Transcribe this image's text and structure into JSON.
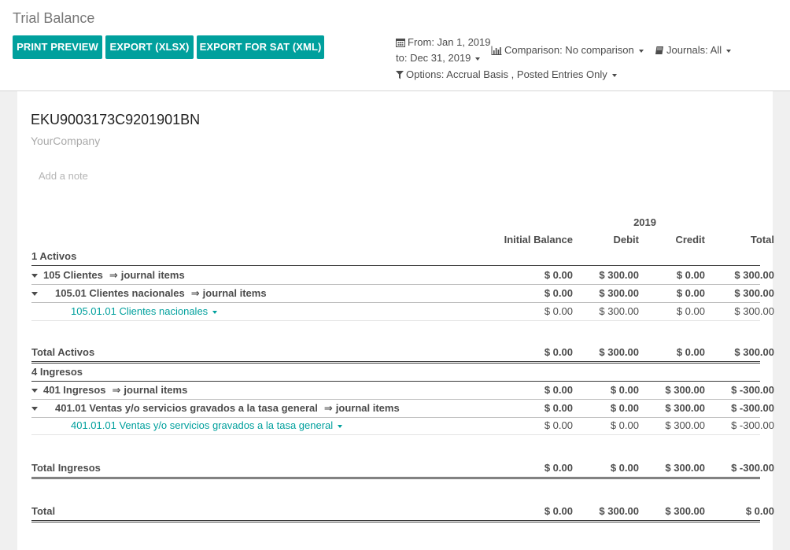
{
  "header": {
    "title": "Trial Balance",
    "buttons": {
      "print": "PRINT PREVIEW",
      "xlsx": "EXPORT (XLSX)",
      "sat": "EXPORT FOR SAT (XML)"
    },
    "date_from": "From: Jan 1, 2019",
    "date_to": "to: Dec 31, 2019",
    "comparison": "Comparison: No comparison",
    "journals": "Journals: All",
    "options": "Options: Accrual Basis , Posted Entries Only"
  },
  "report": {
    "company_id": "EKU9003173C9201901BN",
    "company_name": "YourCompany",
    "note_placeholder": "Add a note",
    "year": "2019",
    "columns": [
      "Initial Balance",
      "Debit",
      "Credit",
      "Total"
    ],
    "journal_items": "journal items",
    "arrow": "⇒",
    "sections": {
      "activos": {
        "title": "1 Activos",
        "group": {
          "label": "105 Clientes",
          "values": [
            "$ 0.00",
            "$ 300.00",
            "$ 0.00",
            "$ 300.00"
          ]
        },
        "sub": {
          "label": "105.01 Clientes nacionales",
          "values": [
            "$ 0.00",
            "$ 300.00",
            "$ 0.00",
            "$ 300.00"
          ]
        },
        "account": {
          "label": "105.01.01 Clientes nacionales",
          "values": [
            "$ 0.00",
            "$ 300.00",
            "$ 0.00",
            "$ 300.00"
          ]
        },
        "total": {
          "label": "Total Activos",
          "values": [
            "$ 0.00",
            "$ 300.00",
            "$ 0.00",
            "$ 300.00"
          ]
        }
      },
      "ingresos": {
        "title": "4 Ingresos",
        "group": {
          "label": "401 Ingresos",
          "values": [
            "$ 0.00",
            "$ 0.00",
            "$ 300.00",
            "$ -300.00"
          ]
        },
        "sub": {
          "label": "401.01 Ventas y/o servicios gravados a la tasa general",
          "values": [
            "$ 0.00",
            "$ 0.00",
            "$ 300.00",
            "$ -300.00"
          ]
        },
        "account": {
          "label": "401.01.01 Ventas y/o servicios gravados a la tasa general",
          "values": [
            "$ 0.00",
            "$ 0.00",
            "$ 300.00",
            "$ -300.00"
          ]
        },
        "total": {
          "label": "Total Ingresos",
          "values": [
            "$ 0.00",
            "$ 0.00",
            "$ 300.00",
            "$ -300.00"
          ]
        }
      }
    },
    "grand_total": {
      "label": "Total",
      "values": [
        "$ 0.00",
        "$ 300.00",
        "$ 300.00",
        "$ 0.00"
      ]
    }
  },
  "icons": {
    "calendar": "calendar-icon",
    "chart": "bar-chart-icon",
    "book": "book-icon",
    "filter": "filter-icon"
  },
  "colors": {
    "accent": "#00a09d"
  }
}
